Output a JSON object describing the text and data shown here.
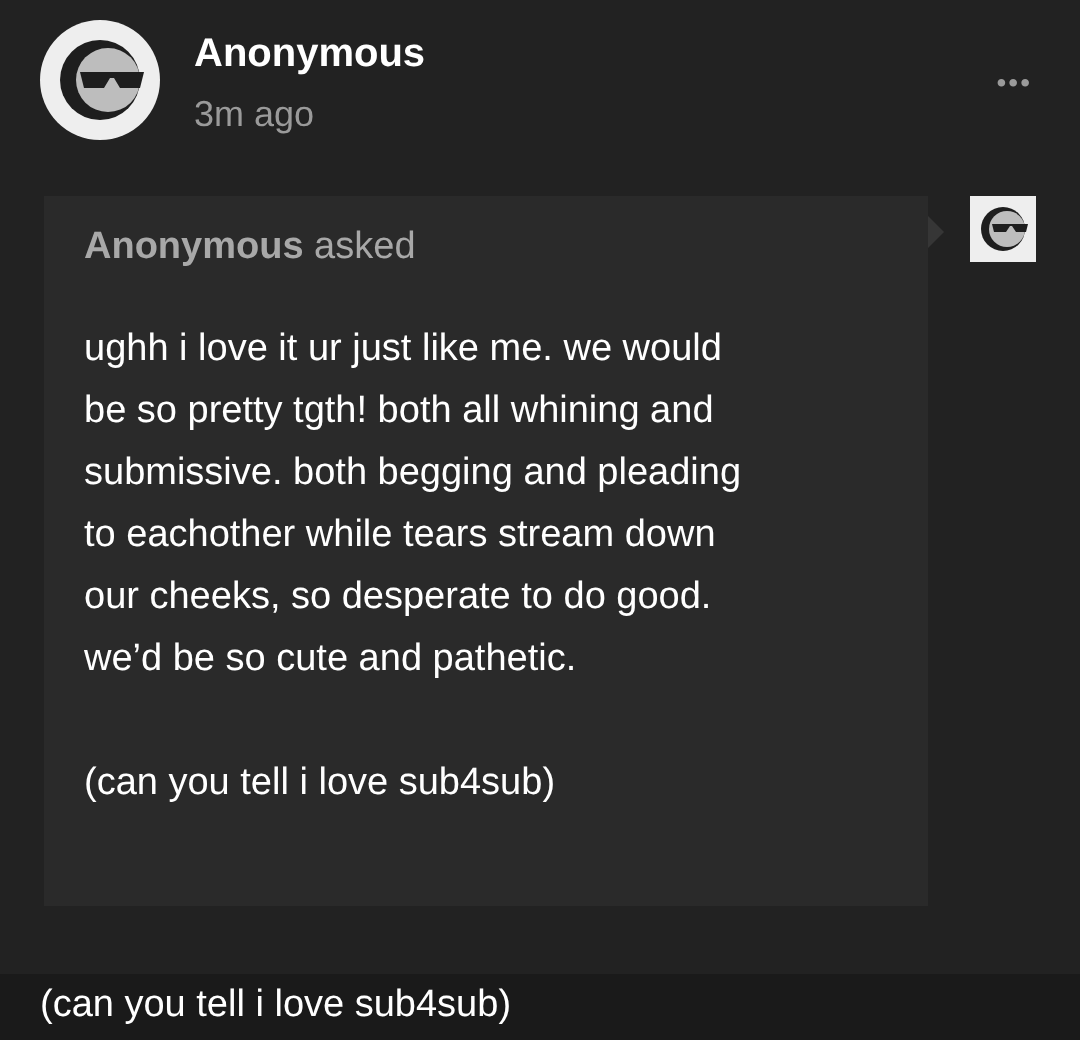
{
  "post": {
    "author": "Anonymous",
    "time": "3m ago",
    "menu": "•••"
  },
  "ask": {
    "asker": "**Anonymous** asked",
    "paragraphs": [
      "ughh i love it ur just like me. we would\nbe so pretty tgth! both all whining and\nsubmissive. both begging and pleading\nto eachother while tears stream down\nour cheeks, so desperate to do good.\nwe’d be so cute and pathetic.",
      "(can you tell i love sub4sub)"
    ]
  },
  "caption": "(can you tell i love sub4sub)"
}
